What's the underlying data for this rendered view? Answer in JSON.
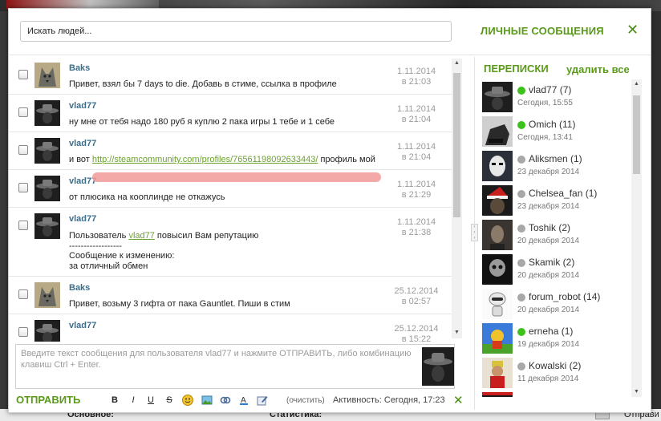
{
  "header": {
    "search_placeholder": "Искать людей...",
    "title": "ЛИЧНЫЕ СООБЩЕНИЯ"
  },
  "messages": [
    {
      "name": "Baks",
      "text": "Привет, взял бы 7 days to die. Добавь в стиме, ссылка в профиле",
      "date1": "1.11.2014",
      "date2": "в 21:03"
    },
    {
      "name": "vlad77",
      "text": "ну мне от тебя надо 180 руб я куплю 2 пака игры 1 тебе и 1 себе",
      "date1": "1.11.2014",
      "date2": "в 21:04"
    },
    {
      "name": "vlad77",
      "text_pre": "и вот ",
      "link": "http://steamcommunity.com/profiles/76561198092633443/",
      "text_post": " профиль мой",
      "date1": "1.11.2014",
      "date2": "в 21:04"
    },
    {
      "name": "vlad77",
      "text": "от плюсика на кооплинде не откажусь",
      "date1": "1.11.2014",
      "date2": "в 21:29"
    },
    {
      "name": "vlad77",
      "text_pre": "Пользователь ",
      "link": "vlad77",
      "text_post": " повысил Вам репутацию",
      "sep": "------------------",
      "line3": "Сообщение к изменению:",
      "line4": "за отличный обмен",
      "date1": "1.11.2014",
      "date2": "в 21:38"
    },
    {
      "name": "Baks",
      "text": "Привет, возьму 3 гифта от пака Gauntlet. Пиши в стим",
      "date1": "25.12.2014",
      "date2": "в 02:57"
    },
    {
      "name": "vlad77",
      "text": "",
      "date1": "25.12.2014",
      "date2": "в 15:22"
    }
  ],
  "compose": {
    "placeholder": "Введите текст сообщения для пользователя vlad77 и нажмите ОТПРАВИТЬ, либо комбинацию клавиш Ctrl + Enter."
  },
  "toolbar": {
    "send_label": "ОТПРАВИТЬ",
    "bold": "B",
    "italic": "I",
    "underline": "U",
    "strike": "S",
    "clear_label": "(очистить)",
    "activity": "Активность: Сегодня, 17:23"
  },
  "conversations": {
    "title": "ПЕРЕПИСКИ",
    "delete_all": "удалить все",
    "items": [
      {
        "name": "vlad77 (7)",
        "date": "Сегодня, 15:55",
        "online": true
      },
      {
        "name": "Omich (11)",
        "date": "Сегодня, 13:41",
        "online": true
      },
      {
        "name": "Aliksmen (1)",
        "date": "23 декабря 2014",
        "online": false
      },
      {
        "name": "Chelsea_fan (1)",
        "date": "23 декабря 2014",
        "online": false
      },
      {
        "name": "Toshik (2)",
        "date": "20 декабря 2014",
        "online": false
      },
      {
        "name": "Skamik (2)",
        "date": "20 декабря 2014",
        "online": false
      },
      {
        "name": "forum_robot (14)",
        "date": "20 декабря 2014",
        "online": false
      },
      {
        "name": "erneha (1)",
        "date": "19 декабря 2014",
        "online": true
      },
      {
        "name": "Kowalski (2)",
        "date": "11 декабря 2014",
        "online": false
      }
    ]
  },
  "background": {
    "label_main": "Основное:",
    "label_stats": "Статистика:",
    "label_right": "Отправи"
  },
  "colors": {
    "accent": "#5a9a1a",
    "name": "#3c6e8a",
    "online": "#3cc21a",
    "offline": "#a8a8a8"
  }
}
